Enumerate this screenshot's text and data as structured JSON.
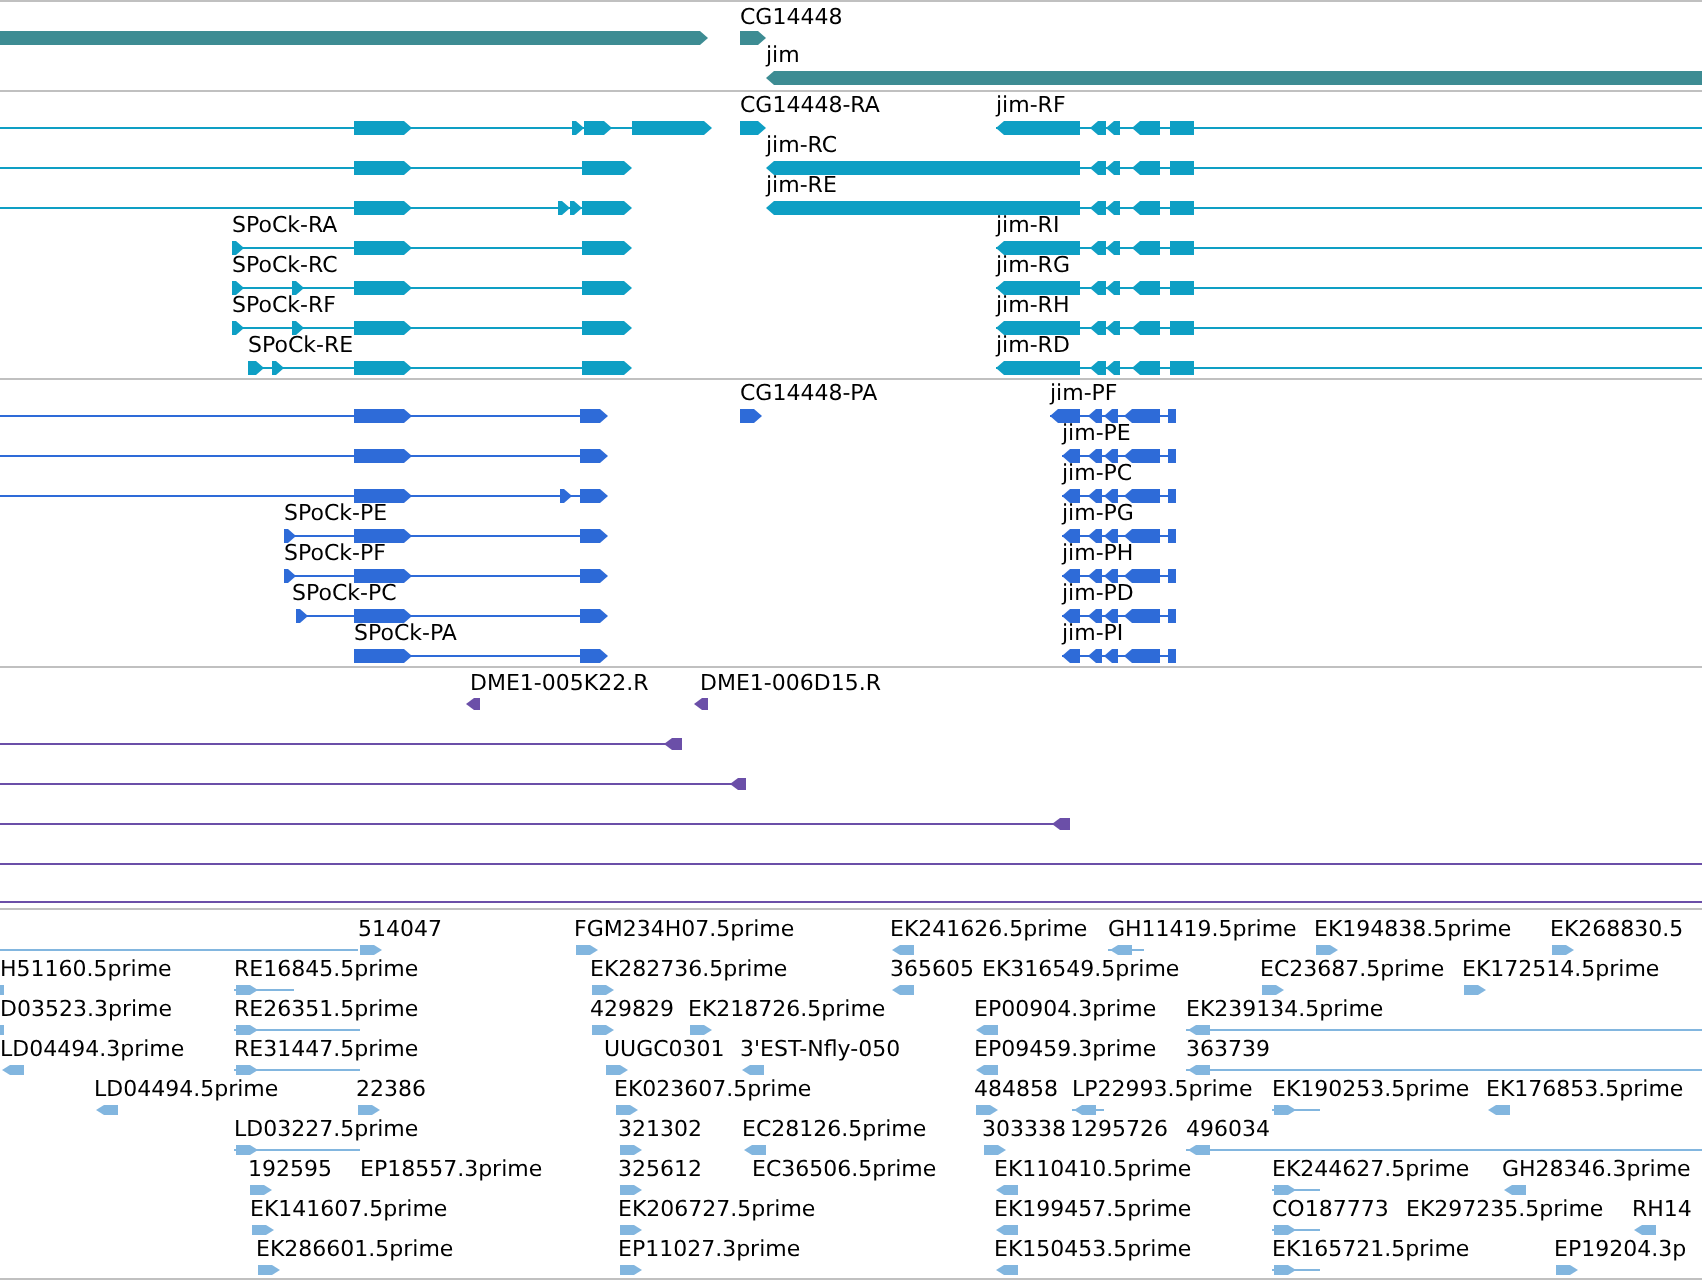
{
  "tracks": [
    {
      "kind": "gene",
      "features": [
        {
          "label": "CG14448"
        },
        {
          "label": "jim"
        }
      ]
    },
    {
      "kind": "mrna",
      "features": [
        {
          "label": "CG14448-RA"
        },
        {
          "label": "jim-RF"
        },
        {
          "label": "jim-RC"
        },
        {
          "label": "jim-RE"
        },
        {
          "label": "SPoCk-RA"
        },
        {
          "label": "jim-RI"
        },
        {
          "label": "SPoCk-RC"
        },
        {
          "label": "jim-RG"
        },
        {
          "label": "SPoCk-RF"
        },
        {
          "label": "jim-RH"
        },
        {
          "label": "SPoCk-RE"
        },
        {
          "label": "jim-RD"
        }
      ]
    },
    {
      "kind": "protein",
      "features": [
        {
          "label": "CG14448-PA"
        },
        {
          "label": "jim-PF"
        },
        {
          "label": "jim-PE"
        },
        {
          "label": "jim-PC"
        },
        {
          "label": "SPoCk-PE"
        },
        {
          "label": "jim-PG"
        },
        {
          "label": "SPoCk-PF"
        },
        {
          "label": "jim-PH"
        },
        {
          "label": "SPoCk-PC"
        },
        {
          "label": "jim-PD"
        },
        {
          "label": "SPoCk-PA"
        },
        {
          "label": "jim-PI"
        }
      ]
    },
    {
      "kind": "clone",
      "features": [
        {
          "label": "DME1-005K22.R"
        },
        {
          "label": "DME1-006D15.R"
        }
      ]
    },
    {
      "kind": "est",
      "features": [
        {
          "label": "514047"
        },
        {
          "label": "FGM234H07.5prime"
        },
        {
          "label": "EK241626.5prime"
        },
        {
          "label": "GH11419.5prime"
        },
        {
          "label": "EK194838.5prime"
        },
        {
          "label": "EK268830.5"
        },
        {
          "label": "H51160.5prime"
        },
        {
          "label": "RE16845.5prime"
        },
        {
          "label": "EK282736.5prime"
        },
        {
          "label": "365605"
        },
        {
          "label": "EK316549.5prime"
        },
        {
          "label": "EC23687.5prime"
        },
        {
          "label": "EK172514.5prime"
        },
        {
          "label": "D03523.3prime"
        },
        {
          "label": "RE26351.5prime"
        },
        {
          "label": "429829"
        },
        {
          "label": "EK218726.5prime"
        },
        {
          "label": "EP00904.3prime"
        },
        {
          "label": "EK239134.5prime"
        },
        {
          "label": "LD04494.3prime"
        },
        {
          "label": "RE31447.5prime"
        },
        {
          "label": "UUGC0301"
        },
        {
          "label": "3'EST-Nfly-050"
        },
        {
          "label": "EP09459.3prime"
        },
        {
          "label": "363739"
        },
        {
          "label": "LD04494.5prime"
        },
        {
          "label": "22386"
        },
        {
          "label": "EK023607.5prime"
        },
        {
          "label": "484858"
        },
        {
          "label": "LP22993.5prime"
        },
        {
          "label": "EK190253.5prime"
        },
        {
          "label": "EK176853.5prime"
        },
        {
          "label": "LD03227.5prime"
        },
        {
          "label": "321302"
        },
        {
          "label": "EC28126.5prime"
        },
        {
          "label": "303338"
        },
        {
          "label": "1295726"
        },
        {
          "label": "496034"
        },
        {
          "label": "192595"
        },
        {
          "label": "EP18557.3prime"
        },
        {
          "label": "325612"
        },
        {
          "label": "EC36506.5prime"
        },
        {
          "label": "EK110410.5prime"
        },
        {
          "label": "EK244627.5prime"
        },
        {
          "label": "GH28346.3prime"
        },
        {
          "label": "EK141607.5prime"
        },
        {
          "label": "EK206727.5prime"
        },
        {
          "label": "EK199457.5prime"
        },
        {
          "label": "CO187773"
        },
        {
          "label": "EK297235.5prime"
        },
        {
          "label": "RH14"
        },
        {
          "label": "EK286601.5prime"
        },
        {
          "label": "EP11027.3prime"
        },
        {
          "label": "EK150453.5prime"
        },
        {
          "label": "EK165721.5prime"
        },
        {
          "label": "EP19204.3p"
        }
      ]
    }
  ]
}
